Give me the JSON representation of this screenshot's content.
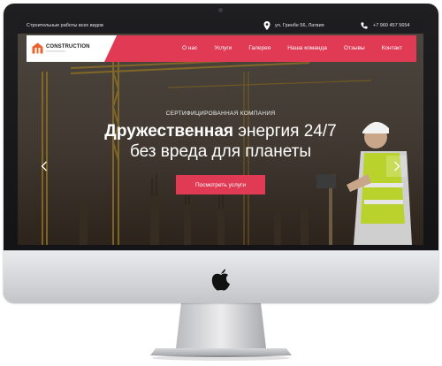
{
  "topbar": {
    "tagline": "Строительные работы всех видов",
    "address": "ул. Гринбе 56, Латвия",
    "phone": "+7 960 457 5654",
    "address_icon": "map-pin-icon",
    "phone_icon": "phone-icon"
  },
  "logo": {
    "name": "CONSTRUCTION",
    "icon": "house-logo-icon"
  },
  "nav": {
    "items": [
      "О нас",
      "Услуги",
      "Галерея",
      "Наша команда",
      "Отзывы",
      "Контакт"
    ]
  },
  "hero": {
    "kicker": "СЕРТИФИЦИРОВАННАЯ КОМПАНИЯ",
    "title_bold": "Дружественная",
    "title_rest": " энергия 24/7",
    "title_line2": "без вреда для планеты",
    "cta_label": "Посмотреть услуги",
    "prev_icon": "chevron-left-icon",
    "next_icon": "chevron-right-icon"
  },
  "colors": {
    "accent": "#e03a55",
    "topbar_bg": "#1d1d1f",
    "monitor_bezel": "#141416",
    "monitor_chin": "#d9dadc"
  }
}
